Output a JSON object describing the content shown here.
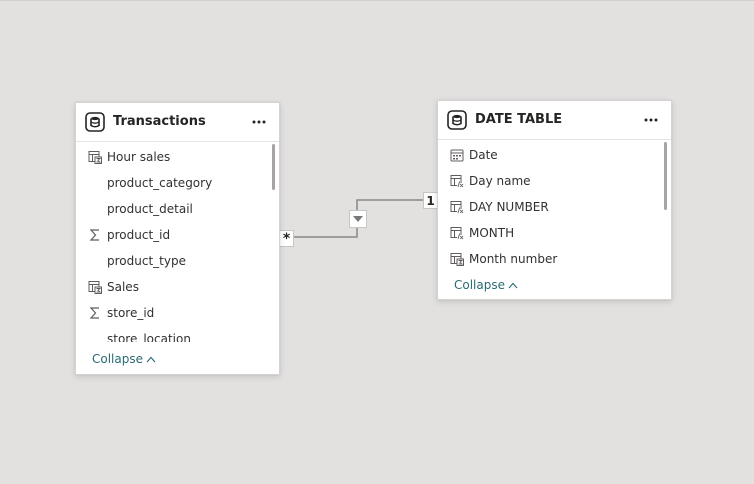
{
  "tables": {
    "transactions": {
      "title": "Transactions",
      "more_label": "···",
      "fields": [
        {
          "name": "Hour sales",
          "icon": "measure-table-icon"
        },
        {
          "name": "product_category",
          "icon": "none"
        },
        {
          "name": "product_detail",
          "icon": "none"
        },
        {
          "name": "product_id",
          "icon": "sigma-icon"
        },
        {
          "name": "product_type",
          "icon": "none"
        },
        {
          "name": "Sales",
          "icon": "measure-table-icon"
        },
        {
          "name": "store_id",
          "icon": "sigma-icon"
        },
        {
          "name": "store_location",
          "icon": "none"
        }
      ],
      "collapse_label": "Collapse"
    },
    "date_table": {
      "title": "DATE TABLE",
      "more_label": "···",
      "fields": [
        {
          "name": "Date",
          "icon": "calendar-icon"
        },
        {
          "name": "Day name",
          "icon": "calculated-column-icon"
        },
        {
          "name": "DAY NUMBER",
          "icon": "calculated-column-icon"
        },
        {
          "name": "MONTH",
          "icon": "calculated-column-icon"
        },
        {
          "name": "Month number",
          "icon": "measure-table-icon"
        }
      ],
      "collapse_label": "Collapse"
    }
  },
  "relationship": {
    "many_side": "*",
    "one_side": "1",
    "filter_icon": "filter-direction-icon"
  },
  "colors": {
    "canvas": "#e2e1e0",
    "card": "#ffffff",
    "link": "#2a6b73",
    "line": "#8a8886"
  }
}
